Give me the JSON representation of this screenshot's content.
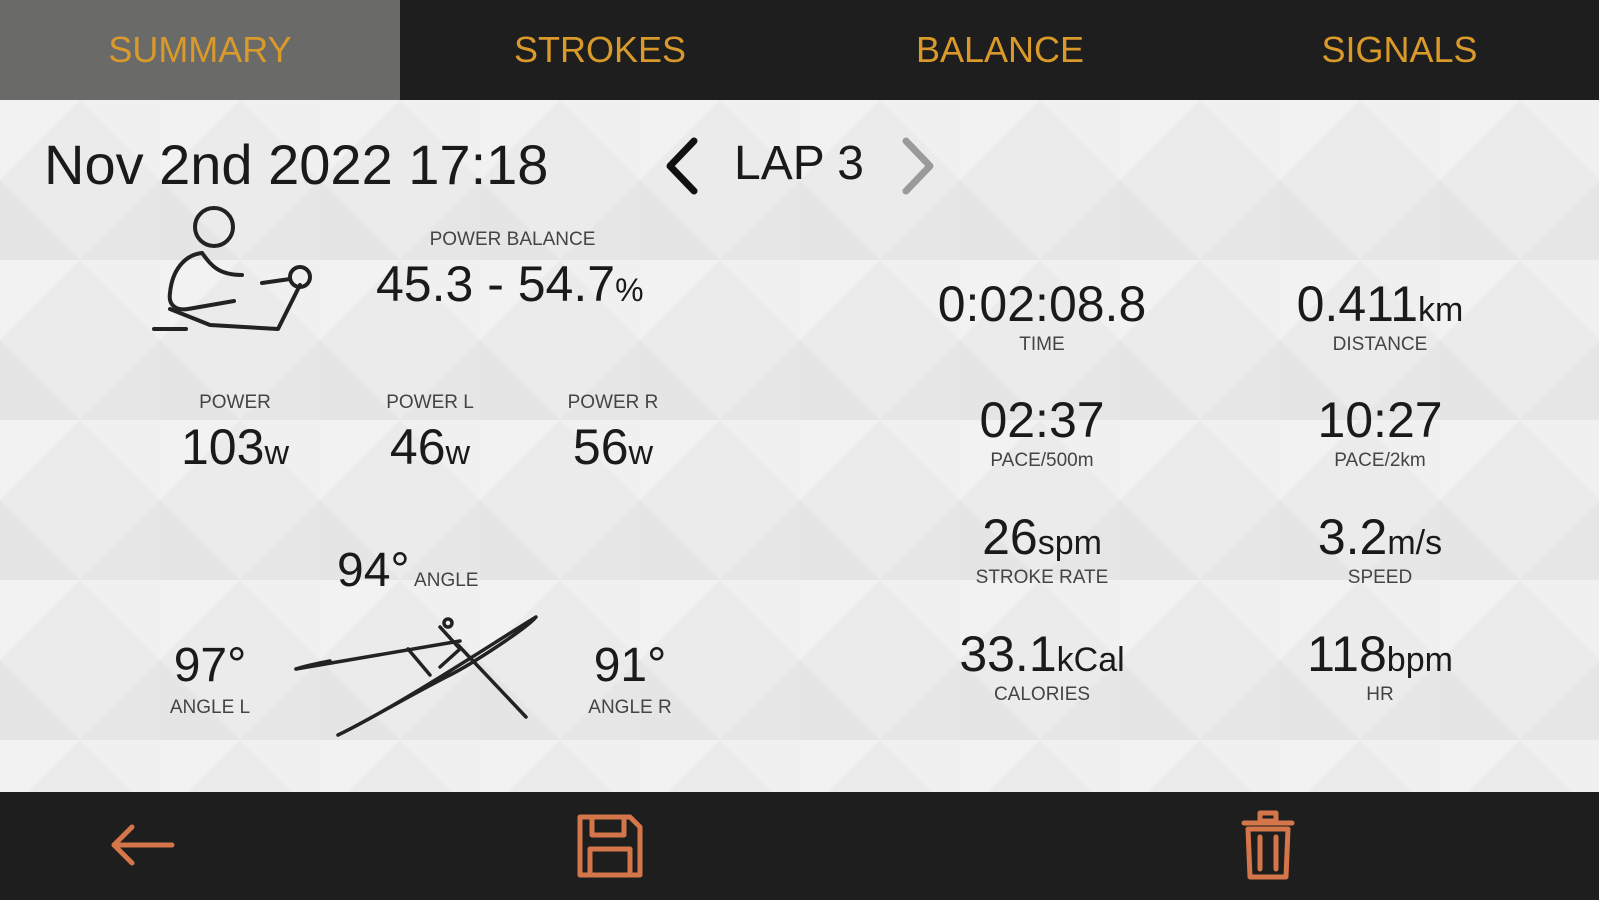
{
  "tabs": [
    {
      "label": "SUMMARY",
      "active": true
    },
    {
      "label": "STROKES",
      "active": false
    },
    {
      "label": "BALANCE",
      "active": false
    },
    {
      "label": "SIGNALS",
      "active": false
    }
  ],
  "session": {
    "date": "Nov 2nd 2022 17:18",
    "lap_label": "LAP 3"
  },
  "power_balance": {
    "label": "POWER BALANCE",
    "value": "45.3 - 54.7",
    "unit": "%"
  },
  "power": {
    "total": {
      "label": "POWER",
      "value": "103",
      "unit": "w"
    },
    "left": {
      "label": "POWER L",
      "value": "46",
      "unit": "w"
    },
    "right": {
      "label": "POWER R",
      "value": "56",
      "unit": "w"
    }
  },
  "angle": {
    "total": {
      "value": "94°",
      "label": "ANGLE"
    },
    "left": {
      "value": "97°",
      "label": "ANGLE L"
    },
    "right": {
      "value": "91°",
      "label": "ANGLE R"
    }
  },
  "metrics": {
    "time": {
      "value": "0:02:08.8",
      "unit": "",
      "label": "TIME"
    },
    "distance": {
      "value": "0.411",
      "unit": "km",
      "label": "DISTANCE"
    },
    "pace500": {
      "value": "02:37",
      "unit": "",
      "label": "PACE/500m"
    },
    "pace2k": {
      "value": "10:27",
      "unit": "",
      "label": "PACE/2km"
    },
    "stroke_rate": {
      "value": "26",
      "unit": "spm",
      "label": "STROKE RATE"
    },
    "speed": {
      "value": "3.2",
      "unit": "m/s",
      "label": "SPEED"
    },
    "calories": {
      "value": "33.1",
      "unit": "kCal",
      "label": "CALORIES"
    },
    "hr": {
      "value": "118",
      "unit": "bpm",
      "label": "HR"
    }
  },
  "icons": {
    "rower": "rower-icon",
    "boat": "boat-oars-icon",
    "back": "back-arrow-icon",
    "save": "save-icon",
    "delete": "trash-icon",
    "prev": "chevron-left-icon",
    "next": "chevron-right-icon"
  },
  "colors": {
    "accent": "#d99a2b",
    "bar_bg": "#1e1e1e",
    "tab_active_bg": "#6a6a69",
    "toolbar_icon": "#d4764a",
    "panel_bg": "#ebebeb"
  }
}
